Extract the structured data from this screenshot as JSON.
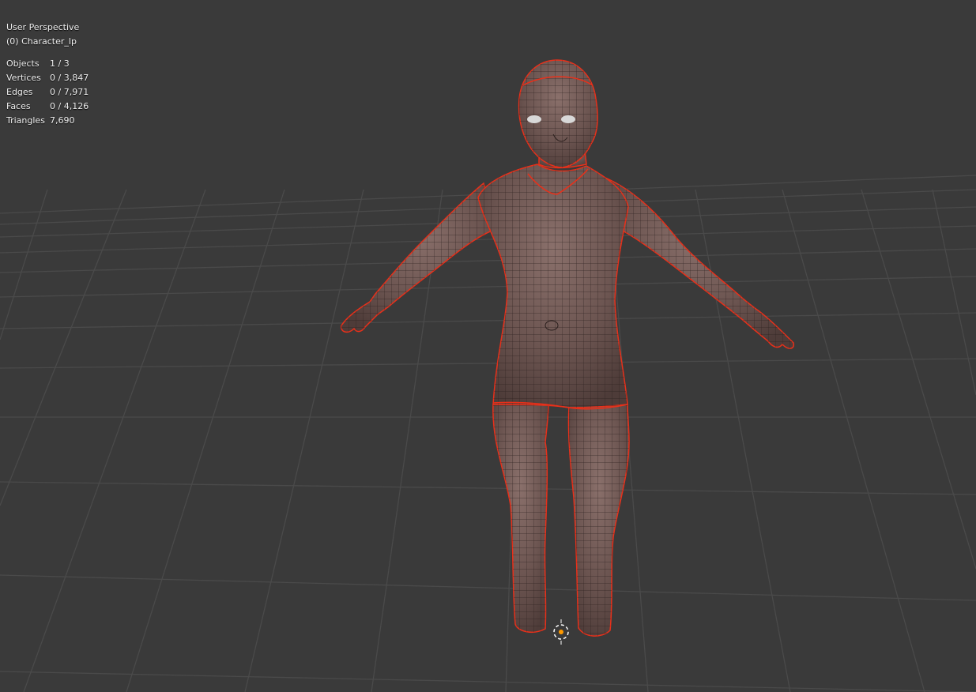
{
  "viewport": {
    "view_mode": "User Perspective",
    "active_object": "(0) Character_lp"
  },
  "stats": [
    {
      "label": "Objects",
      "value": "1 / 3"
    },
    {
      "label": "Vertices",
      "value": "0 / 3,847"
    },
    {
      "label": "Edges",
      "value": "0 / 7,971"
    },
    {
      "label": "Faces",
      "value": "0 / 4,126"
    },
    {
      "label": "Triangles",
      "value": "7,690"
    }
  ],
  "colors": {
    "background": "#3a3a3a",
    "grid_line": "#4a4a4a",
    "mesh_fill": "#6b5450",
    "seam": "#e8301a",
    "origin": "#ff9a00"
  }
}
